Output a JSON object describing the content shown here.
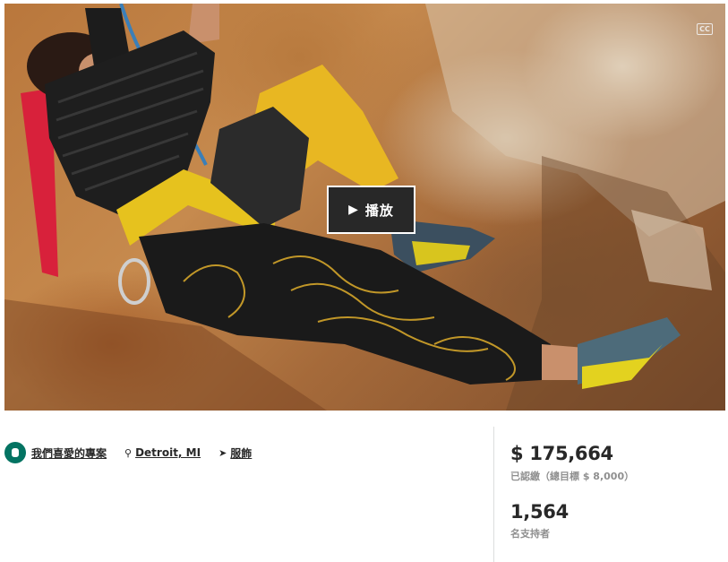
{
  "video": {
    "play_label": "播放",
    "play_icon": "play-icon",
    "cc_label": "CC"
  },
  "project_meta": {
    "badge_label": "我們喜愛的專案",
    "location": "Detroit, MI",
    "category": "服飾",
    "badge_color": "#037362"
  },
  "stats": {
    "pledged": "$ 175,664",
    "goal_text": "已認繳（總目標 $ 8,000）",
    "backers_count": "1,564",
    "backers_label": "名支持者"
  }
}
